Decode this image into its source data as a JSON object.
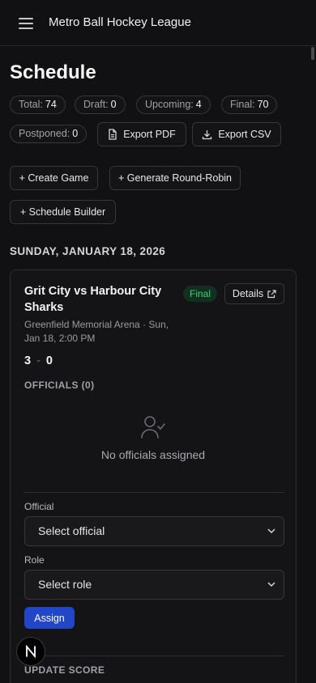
{
  "header": {
    "title": "Metro Ball Hockey League",
    "menu_icon": "hamburger-menu-icon"
  },
  "page": {
    "title": "Schedule"
  },
  "stats": [
    {
      "label": "Total:",
      "value": "74"
    },
    {
      "label": "Draft:",
      "value": "0"
    },
    {
      "label": "Upcoming:",
      "value": "4"
    },
    {
      "label": "Final:",
      "value": "70"
    },
    {
      "label": "Postponed:",
      "value": "0"
    }
  ],
  "actions": {
    "export_pdf": "Export PDF",
    "export_csv": "Export CSV",
    "create_game": "+ Create Game",
    "round_robin": "+ Generate Round-Robin",
    "schedule_builder": "+ Schedule Builder"
  },
  "date_heading": "SUNDAY, JANUARY 18, 2026",
  "game": {
    "title": "Grit City vs Harbour City Sharks",
    "meta": "Greenfield Memorial Arena · Sun, Jan 18, 2:00 PM",
    "status": "Final",
    "details_label": "Details",
    "score_home": "3",
    "score_sep": "-",
    "score_away": "0",
    "officials_heading": "OFFICIALS (0)",
    "no_officials": "No officials assigned",
    "official_label": "Official",
    "official_placeholder": "Select official",
    "role_label": "Role",
    "role_placeholder": "Select role",
    "assign_label": "Assign",
    "update_score_heading": "UPDATE SCORE"
  },
  "fab": {
    "label": "N"
  },
  "colors": {
    "background": "#111113",
    "status_final": "#3fcf74",
    "primary": "#2146c7"
  }
}
